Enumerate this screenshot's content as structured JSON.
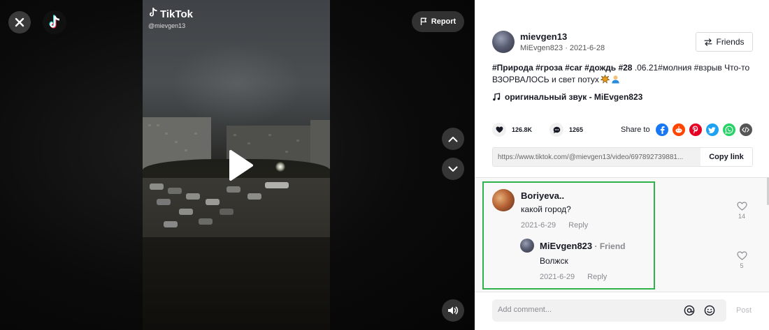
{
  "video": {
    "brand": "TikTok",
    "handle": "@mievgen13",
    "report_label": "Report"
  },
  "author": {
    "username": "mievgen13",
    "subline": "MiEvgen823 · 2021-6-28",
    "friends_label": "Friends"
  },
  "description": {
    "tags": "#Природа #гроза #car #дождь #28",
    "rest": " .06.21#молния #взрыв Что-то ВЗОРВАЛОСЬ и свет потух"
  },
  "music": {
    "label": "оригинальный звук - MiEvgen823"
  },
  "stats": {
    "likes": "126.8K",
    "comments": "1265",
    "share_label": "Share to"
  },
  "share_icons": [
    "facebook-icon",
    "reddit-icon",
    "pinterest-icon",
    "twitter-icon",
    "whatsapp-icon",
    "embed-icon"
  ],
  "link": {
    "url": "https://www.tiktok.com/@mievgen13/video/697892739881...",
    "copy_label": "Copy link"
  },
  "comments": [
    {
      "name": "Boriyeva..",
      "text": "какой город?",
      "date": "2021-6-29",
      "reply_label": "Reply",
      "likes": "14"
    },
    {
      "name": "MiEvgen823",
      "badge": " · Friend",
      "text": "Волжск",
      "date": "2021-6-29",
      "reply_label": "Reply",
      "likes": "5"
    }
  ],
  "comment_bar": {
    "placeholder": "Add comment...",
    "post_label": "Post"
  },
  "colors": {
    "highlight": "#2fb24c",
    "facebook": "#1877f2",
    "reddit": "#ff4500",
    "pinterest": "#e60023",
    "twitter": "#1da1f2",
    "whatsapp": "#25d366",
    "embed": "#555555"
  }
}
